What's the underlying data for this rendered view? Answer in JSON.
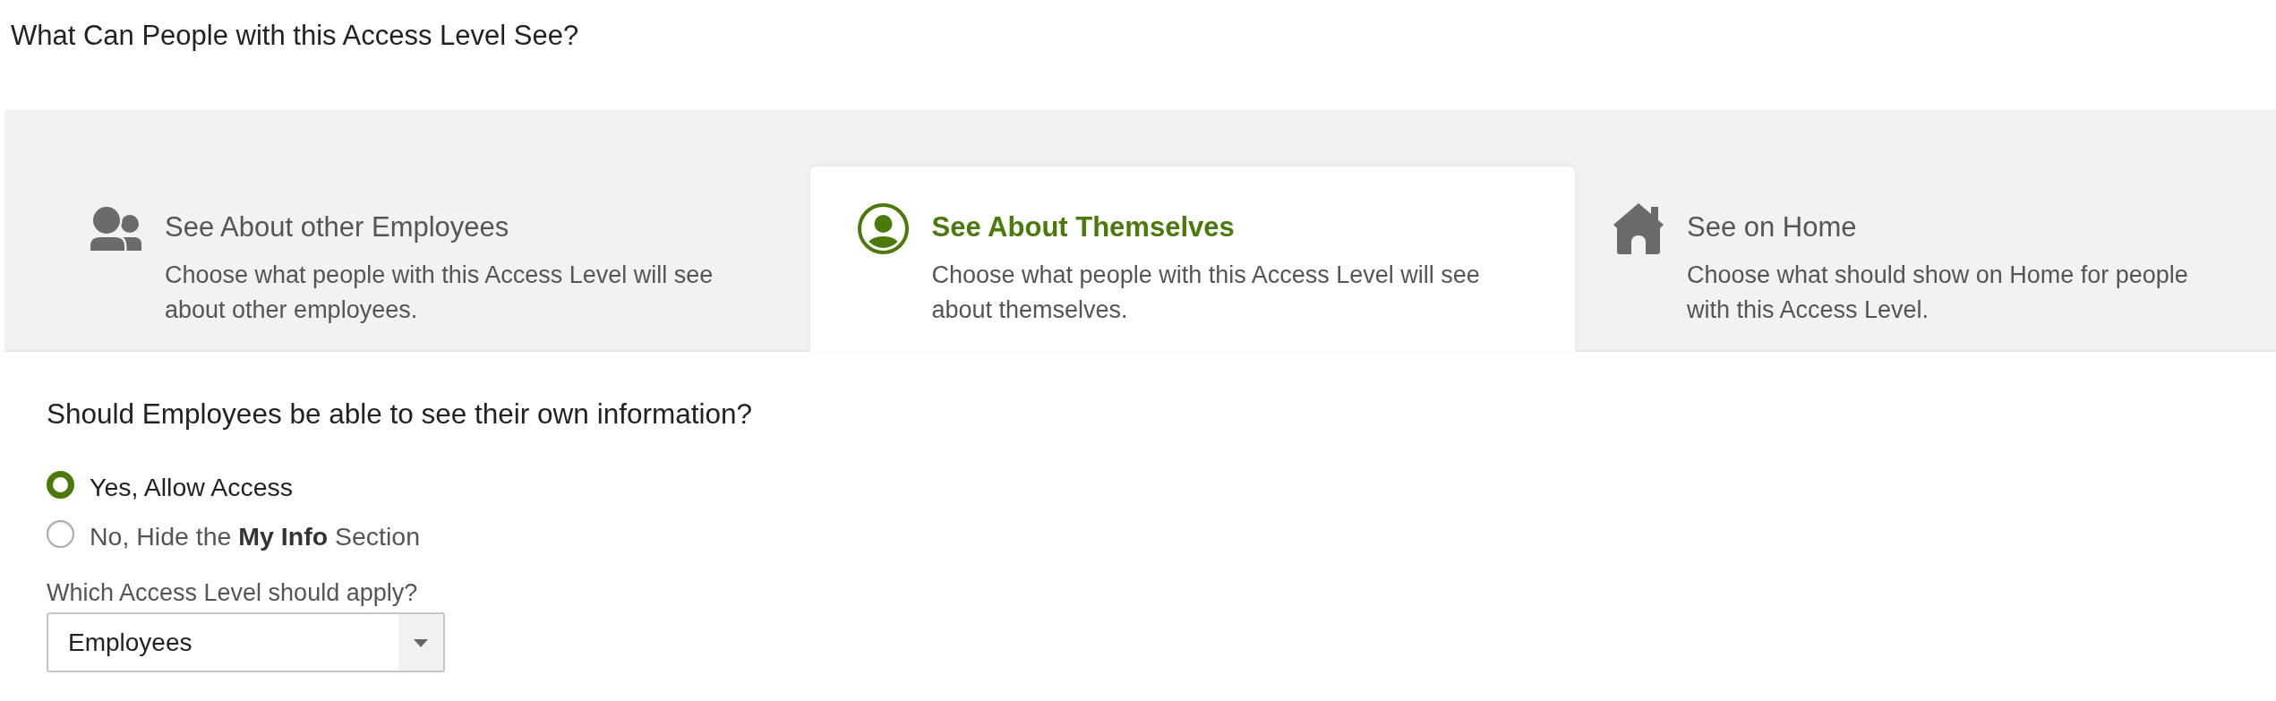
{
  "page": {
    "title": "What Can People with this Access Level See?"
  },
  "tabs": [
    {
      "kind": "people",
      "title": "See About other Employees",
      "description": "Choose what people with this Access Level will see about other employees.",
      "selected": false
    },
    {
      "kind": "person",
      "title": "See About Themselves",
      "description": "Choose what people with this Access Level will see about themselves.",
      "selected": true
    },
    {
      "kind": "home",
      "title": "See on Home",
      "description": "Choose what should show on Home for people with this Access Level.",
      "selected": false
    }
  ],
  "question": {
    "label": "Should Employees be able to see their own information?",
    "options": [
      {
        "label": "Yes, Allow Access",
        "selected": true
      },
      {
        "label": "No, Hide the **My Info** Section",
        "selected": false
      }
    ]
  },
  "access_level": {
    "label": "Which Access Level should apply?",
    "value": "Employees"
  }
}
